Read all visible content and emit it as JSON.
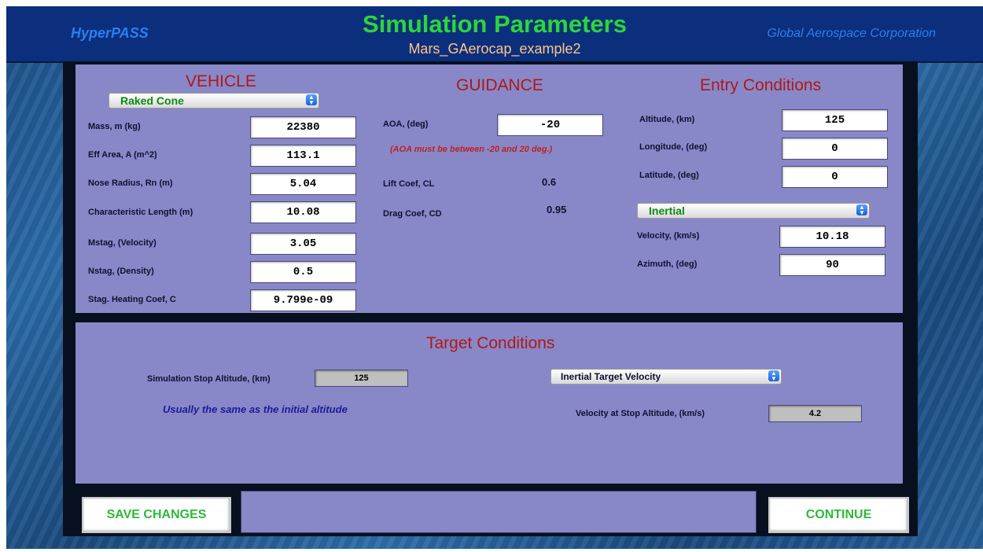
{
  "header": {
    "app_name": "HyperPASS",
    "title": "Simulation Parameters",
    "subtitle": "Mars_GAerocap_example2",
    "company": "Global Aerospace Corporation"
  },
  "vehicle": {
    "title": "VEHICLE",
    "shape_select": "Raked Cone",
    "fields": [
      {
        "label": "Mass, m     (kg)",
        "value": "22380"
      },
      {
        "label": "Eff Area, A (m^2)",
        "value": "113.1"
      },
      {
        "label": "Nose Radius, Rn (m)",
        "value": "5.04"
      },
      {
        "label": "Characteristic Length (m)",
        "value": "10.08"
      },
      {
        "label": "Mstag, (Velocity)",
        "value": "3.05"
      },
      {
        "label": "Nstag, (Density)",
        "value": "0.5"
      },
      {
        "label": "Stag. Heating Coef, C",
        "value": "9.799e-09"
      }
    ]
  },
  "guidance": {
    "title": "GUIDANCE",
    "aoa_label": "AOA, (deg)",
    "aoa_value": "-20",
    "aoa_note": "(AOA must be between -20 and 20 deg.)",
    "lift_label": "Lift Coef, CL",
    "lift_value": "0.6",
    "drag_label": "Drag Coef, CD",
    "drag_value": "0.95"
  },
  "entry": {
    "title": "Entry Conditions",
    "altitude_label": "Altitude,       (km)",
    "altitude_value": "125",
    "longitude_label": "Longitude, (deg)",
    "longitude_value": "0",
    "latitude_label": "Latitude, (deg)",
    "latitude_value": "0",
    "frame_select": "Inertial",
    "velocity_label": "Velocity, (km/s)",
    "velocity_value": "10.18",
    "azimuth_label": "Azimuth, (deg)",
    "azimuth_value": "90"
  },
  "target": {
    "title": "Target Conditions",
    "stop_alt_label": "Simulation Stop Altitude, (km)",
    "stop_alt_value": "125",
    "stop_alt_note": "Usually the same as the initial altitude",
    "velocity_type_select": "Inertial Target Velocity",
    "stop_vel_label": "Velocity at Stop Altitude, (km/s)",
    "stop_vel_value": "4.2"
  },
  "footer": {
    "save_label": "SAVE CHANGES",
    "continue_label": "CONTINUE"
  },
  "colors": {
    "panel": "#8888c8",
    "header": "#0b2f7c",
    "title_green": "#2bd63a",
    "section_red": "#b01818"
  }
}
